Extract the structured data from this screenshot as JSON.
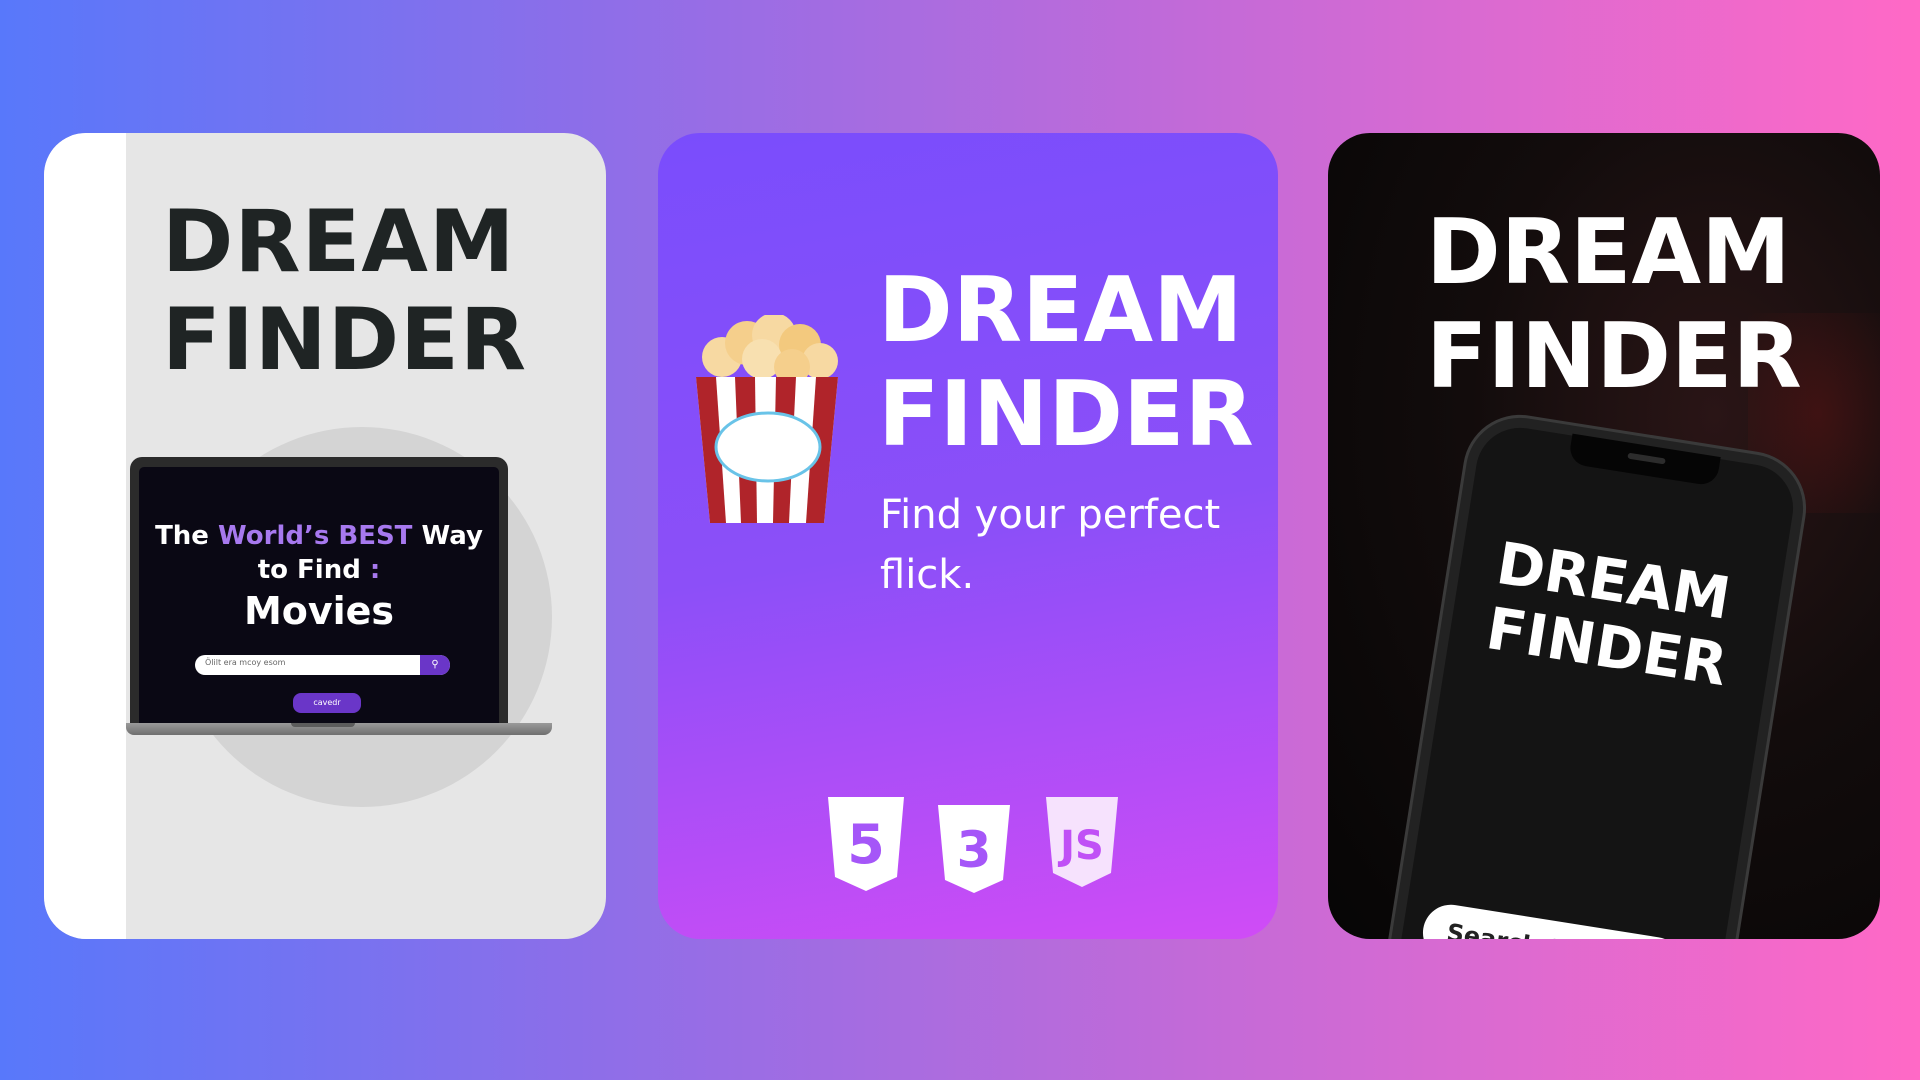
{
  "cards": {
    "light": {
      "title_line1": "DREAM",
      "title_line2": "FINDER",
      "laptop": {
        "headline_the": "The",
        "headline_accent": "World’s BEST",
        "headline_way": "Way",
        "headline_line2": "to Find",
        "headline_colon": ":",
        "headline_movies": "Movies",
        "search_placeholder": "Ölilt era mcoy esom",
        "search_icon": "search-icon",
        "button_label": "cavedr"
      }
    },
    "purple": {
      "title_line1": "DREAM",
      "title_line2": "FINDER",
      "tagline": "Find your perfect flick.",
      "popcorn_icon": "popcorn-icon",
      "tech": [
        "html5-icon",
        "css3-icon",
        "javascript-icon"
      ]
    },
    "dark": {
      "title_line1": "DREAM",
      "title_line2": "FINDER",
      "phone_title_line1": "DREAM",
      "phone_title_line2": "FINDER",
      "search_text": "Search for movies..."
    }
  },
  "colors": {
    "accent_purple": "#a779ef",
    "button_purple": "#6a36c8",
    "card2_start": "#7a4dfc",
    "card2_end": "#d04cf6"
  }
}
